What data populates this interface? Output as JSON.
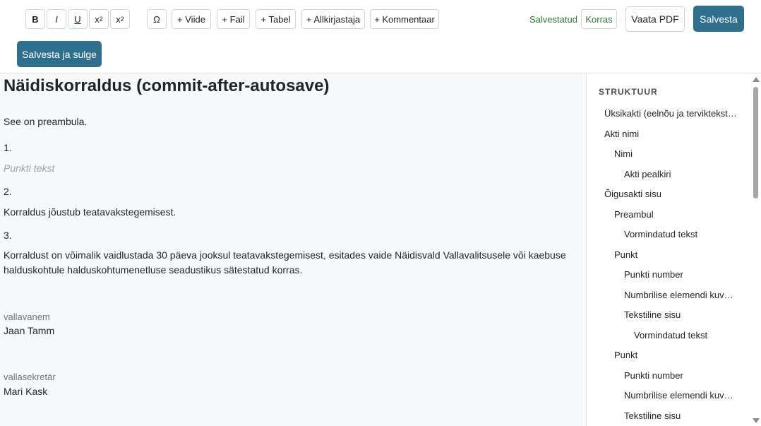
{
  "toolbar": {
    "bold": "B",
    "italic": "I",
    "underline": "U",
    "superscript_base": "x",
    "superscript_mark": "2",
    "subscript_base": "x",
    "subscript_mark": "2",
    "special_char": "Ω",
    "add_reference": "+ Viide",
    "add_file": "+ Fail",
    "add_table": "+ Tabel",
    "add_signer": "+ Allkirjastaja",
    "add_comment": "+ Kommentaar",
    "status_saved": "Salvestatud",
    "status_ok": "Korras",
    "view_pdf": "Vaata PDF",
    "save": "Salvesta",
    "save_close": "Salvesta ja sulge"
  },
  "document": {
    "title": "Näidiskorraldus (commit-after-autosave)",
    "preamble": "See on preambula.",
    "points": [
      {
        "number": "1.",
        "text": "Punkti tekst"
      },
      {
        "number": "2.",
        "text": "Korraldus jõustub teatavakstegemisest."
      },
      {
        "number": "3.",
        "text": "Korraldust on võimalik vaidlustada 30 päeva jooksul teatavakstegemisest, esitades vaide Näidisvald Vallavalitsusele või kaebuse halduskohtule halduskohtumenetluse seadustikus sätestatud korras."
      }
    ],
    "signers": [
      {
        "role": "vallavanem",
        "name": "Jaan Tamm"
      },
      {
        "role": "vallasekretär",
        "name": "Mari Kask"
      }
    ]
  },
  "sidebar": {
    "title": "STRUKTUUR",
    "items": [
      {
        "label": "Üksikakti (eelnõu ja terviktekst…"
      },
      {
        "label": "Akti nimi"
      },
      {
        "label": "Nimi"
      },
      {
        "label": "Akti pealkiri"
      },
      {
        "label": "Õigusakti sisu"
      },
      {
        "label": "Preambul"
      },
      {
        "label": "Vormindatud tekst"
      },
      {
        "label": "Punkt"
      },
      {
        "label": "Punkti number"
      },
      {
        "label": "Numbrilise elemendi kuv…"
      },
      {
        "label": "Tekstiline sisu"
      },
      {
        "label": "Vormindatud tekst"
      },
      {
        "label": "Punkt"
      },
      {
        "label": "Punkti number"
      },
      {
        "label": "Numbrilise elemendi kuv…"
      },
      {
        "label": "Tekstiline sisu"
      }
    ]
  }
}
